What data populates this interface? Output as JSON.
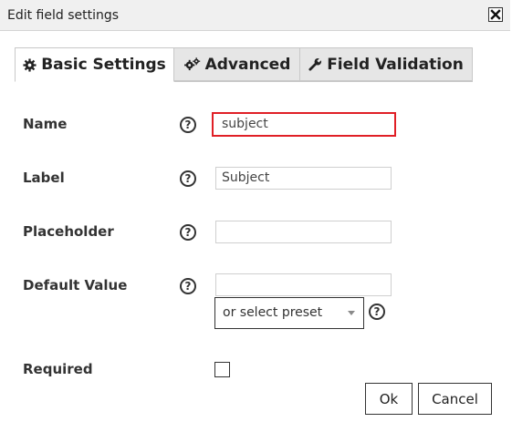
{
  "dialog": {
    "title": "Edit field settings"
  },
  "tabs": [
    {
      "label": "Basic Settings",
      "icon": "gear-icon",
      "active": true
    },
    {
      "label": "Advanced",
      "icon": "gears-icon",
      "active": false
    },
    {
      "label": "Field Validation",
      "icon": "wrench-icon",
      "active": false
    }
  ],
  "form": {
    "name": {
      "label": "Name",
      "value": "subject"
    },
    "label": {
      "label": "Label",
      "value": "Subject"
    },
    "placeholder": {
      "label": "Placeholder",
      "value": ""
    },
    "default_value": {
      "label": "Default Value",
      "value": "",
      "preset_select": "or select preset"
    },
    "required": {
      "label": "Required",
      "checked": false
    },
    "help_glyph": "?"
  },
  "buttons": {
    "ok": "Ok",
    "cancel": "Cancel"
  },
  "colors": {
    "focus_border": "#e01f26",
    "tab_inactive_bg": "#e6e6e6",
    "titlebar_bg": "#f0f0f0"
  }
}
